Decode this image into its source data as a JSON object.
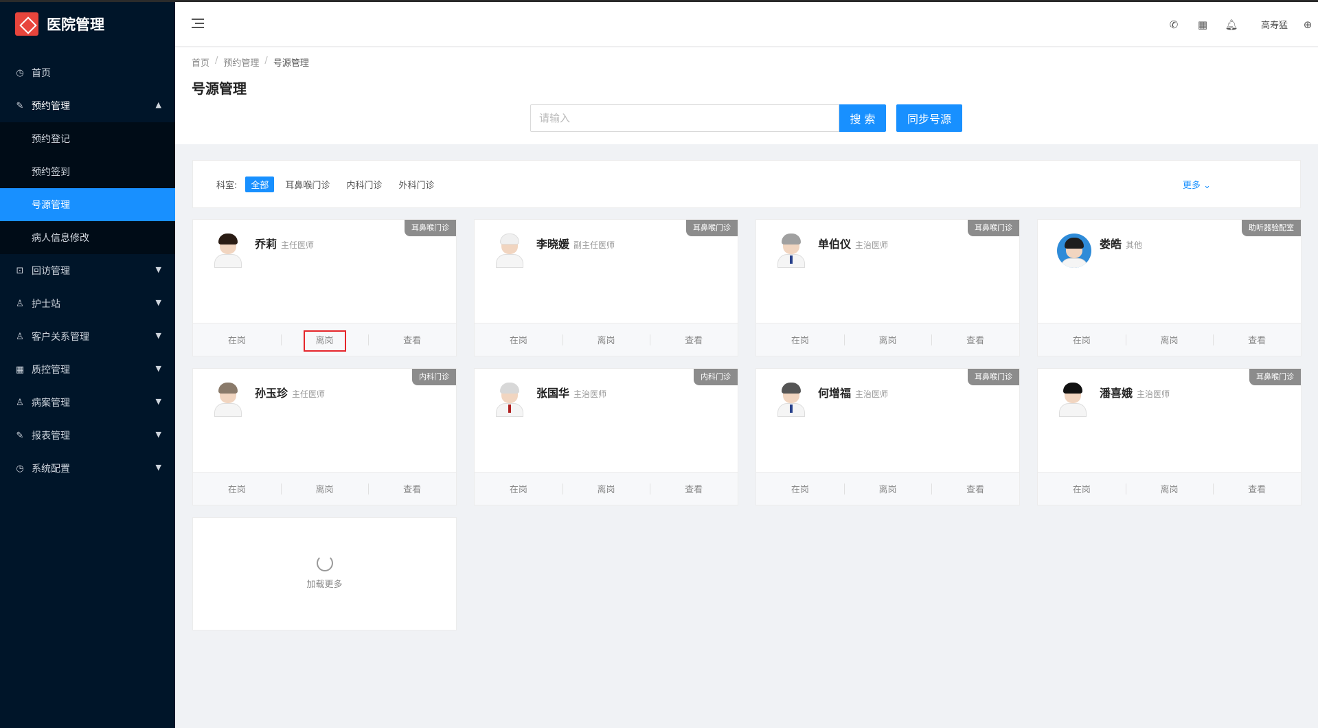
{
  "app": {
    "title": "医院管理"
  },
  "sidebar": {
    "items": [
      {
        "label": "首页",
        "icon": "dashboard-icon"
      },
      {
        "label": "预约管理",
        "icon": "edit-icon",
        "open": true,
        "children": [
          {
            "label": "预约登记"
          },
          {
            "label": "预约签到"
          },
          {
            "label": "号源管理",
            "active": true
          },
          {
            "label": "病人信息修改"
          }
        ]
      },
      {
        "label": "回访管理",
        "icon": "lock-icon"
      },
      {
        "label": "护士站",
        "icon": "user-icon"
      },
      {
        "label": "客户关系管理",
        "icon": "user-icon"
      },
      {
        "label": "质控管理",
        "icon": "table-icon"
      },
      {
        "label": "病案管理",
        "icon": "user-icon"
      },
      {
        "label": "报表管理",
        "icon": "edit-icon"
      },
      {
        "label": "系统配置",
        "icon": "dashboard-icon"
      }
    ]
  },
  "header": {
    "user": "高寿猛"
  },
  "breadcrumb": [
    "首页",
    "预约管理",
    "号源管理"
  ],
  "page": {
    "title": "号源管理"
  },
  "search": {
    "placeholder": "请输入",
    "search_label": "搜 索",
    "sync_label": "同步号源"
  },
  "filter": {
    "label": "科室:",
    "departments": [
      "全部",
      "耳鼻喉门诊",
      "内科门诊",
      "外科门诊"
    ],
    "more": "更多"
  },
  "actions": {
    "on_duty": "在岗",
    "off_duty": "离岗",
    "view": "查看"
  },
  "doctors": [
    {
      "name": "乔莉",
      "title": "主任医师",
      "dept": "耳鼻喉门诊"
    },
    {
      "name": "李晓媛",
      "title": "副主任医师",
      "dept": "耳鼻喉门诊"
    },
    {
      "name": "单伯仪",
      "title": "主治医师",
      "dept": "耳鼻喉门诊"
    },
    {
      "name": "娄皓",
      "title": "其他",
      "dept": "助听器验配室"
    },
    {
      "name": "孙玉珍",
      "title": "主任医师",
      "dept": "内科门诊"
    },
    {
      "name": "张国华",
      "title": "主治医师",
      "dept": "内科门诊"
    },
    {
      "name": "何增福",
      "title": "主治医师",
      "dept": "耳鼻喉门诊"
    },
    {
      "name": "潘喜娥",
      "title": "主治医师",
      "dept": "耳鼻喉门诊"
    }
  ],
  "loadmore": {
    "label": "加载更多"
  }
}
